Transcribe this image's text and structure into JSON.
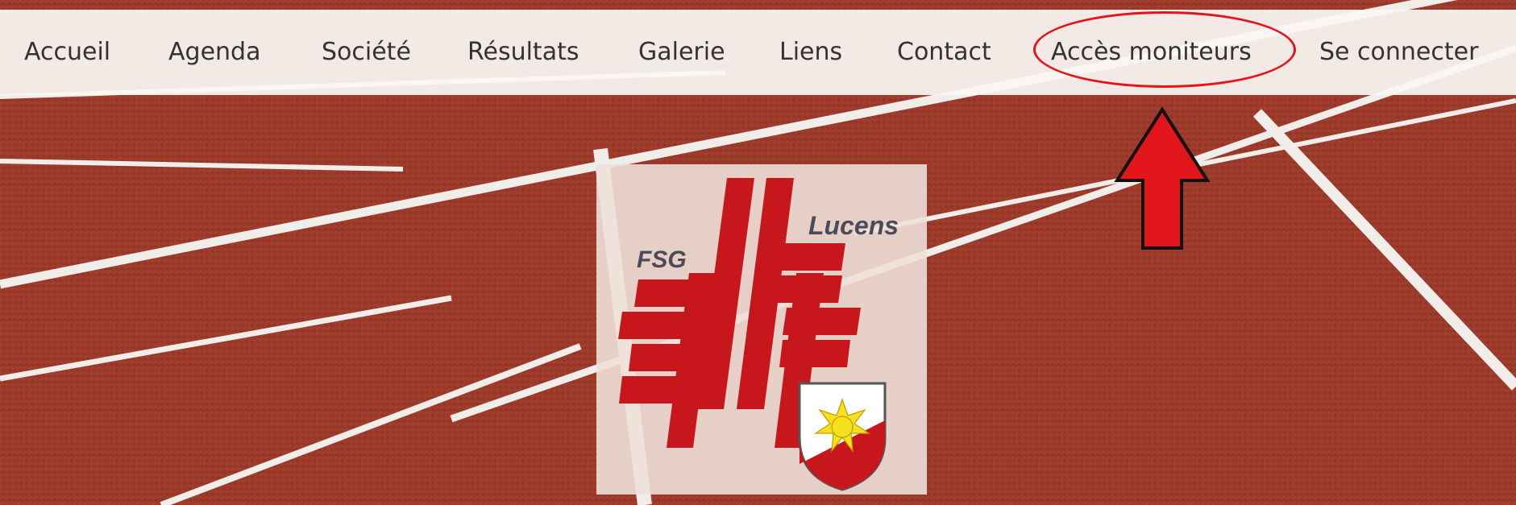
{
  "nav": {
    "items": [
      {
        "label": "Accueil"
      },
      {
        "label": "Agenda"
      },
      {
        "label": "Société"
      },
      {
        "label": "Résultats"
      },
      {
        "label": "Galerie"
      },
      {
        "label": "Liens"
      },
      {
        "label": "Contact"
      },
      {
        "label": "Accès moniteurs"
      },
      {
        "label": "Se connecter"
      }
    ]
  },
  "logo": {
    "left_text": "FSG",
    "right_text": "Lucens"
  },
  "colors": {
    "track": "#9c3a2a",
    "lane_line": "#f4f1ee",
    "logo_red": "#c8161d",
    "annotation_red": "#e4141b",
    "nav_text": "#333333",
    "crest_yellow": "#f6e21c"
  },
  "annotation": {
    "target": "Accès moniteurs",
    "shape": "ellipse",
    "pointer": "arrow-up-icon"
  }
}
